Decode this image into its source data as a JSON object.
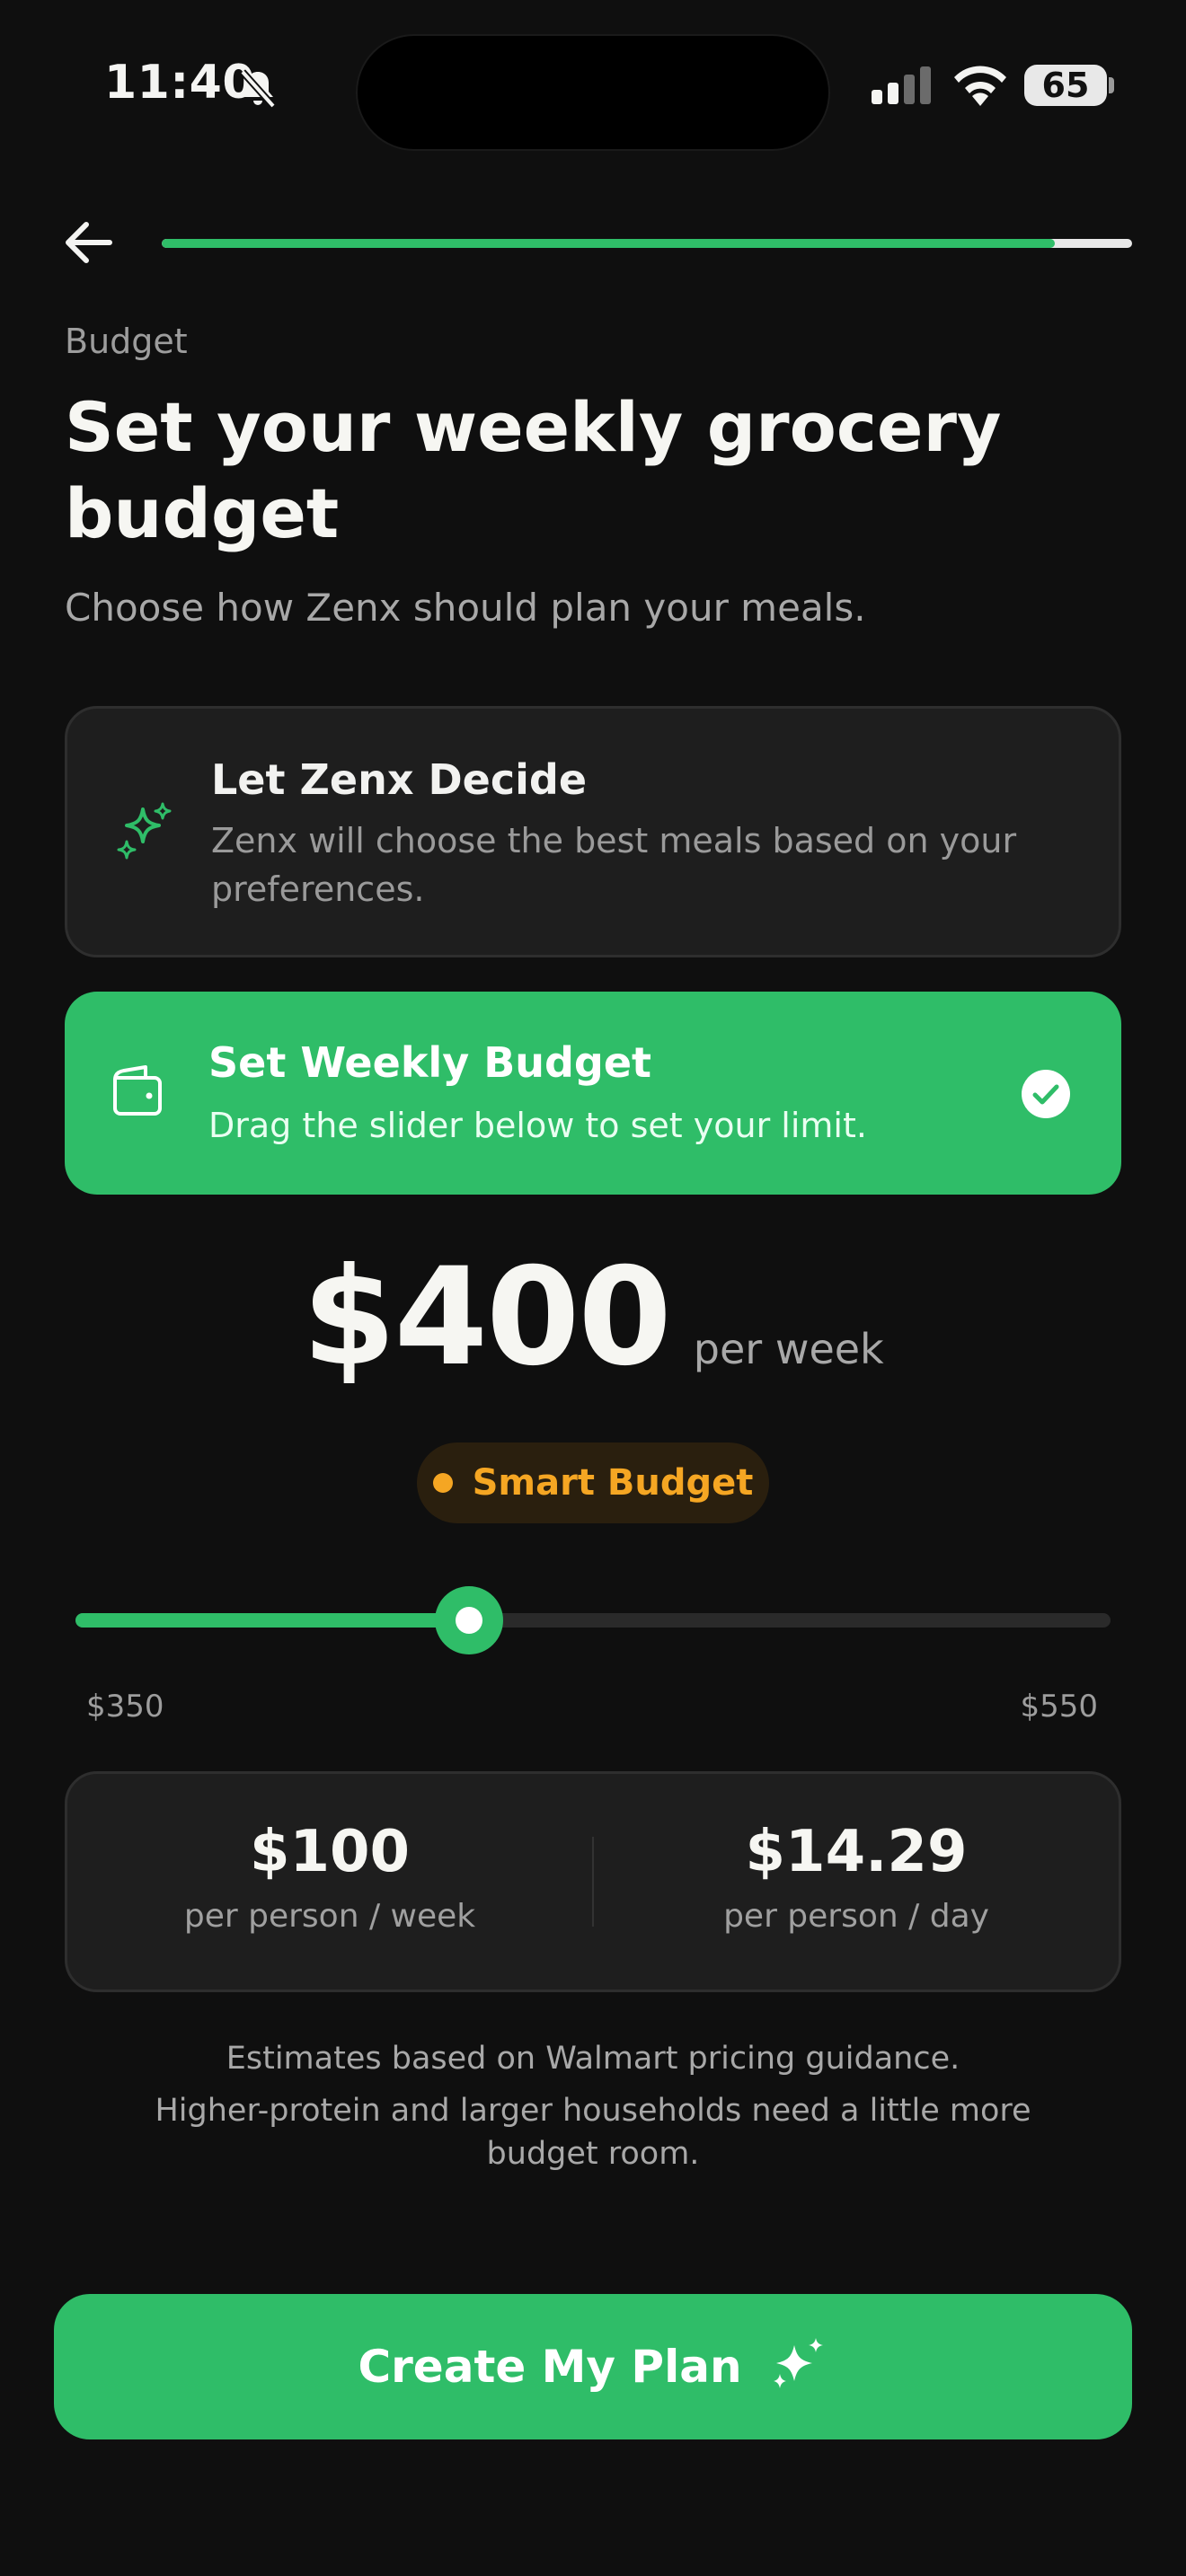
{
  "status_bar": {
    "time": "11:40",
    "battery": "65",
    "icons": [
      "bell-muted-icon",
      "cellular-signal-icon",
      "wifi-icon",
      "battery-icon"
    ]
  },
  "header": {
    "back_icon": "arrow-left-icon",
    "progress": 0.92
  },
  "page": {
    "eyebrow": "Budget",
    "title": "Set your weekly grocery budget",
    "subtitle": "Choose how Zenx should plan your meals."
  },
  "options": [
    {
      "title": "Let Zenx Decide",
      "description": "Zenx will choose the best meals based on your preferences.",
      "icon": "sparkles-icon",
      "selected": false
    },
    {
      "title": "Set Weekly Budget",
      "description": "Drag the slider below to set your limit.",
      "icon": "wallet-icon",
      "selected": true
    }
  ],
  "budget": {
    "amount": "$400",
    "unit": "per week",
    "badge": "Smart Budget",
    "min_label": "$350",
    "max_label": "$550",
    "value": 400,
    "min": 350,
    "max": 550
  },
  "stats": [
    {
      "value": "$100",
      "label": "per person / week"
    },
    {
      "value": "$14.29",
      "label": "per person / day"
    }
  ],
  "notes": {
    "line1": "Estimates based on Walmart pricing guidance.",
    "line2": "Higher-protein and larger households need a little more budget room."
  },
  "cta": {
    "label": "Create My Plan",
    "icon": "sparkles-icon"
  },
  "colors": {
    "background": "#0f0f0f",
    "accent_green": "#2fbd68",
    "badge_orange": "#f5a623",
    "card": "#1e1e1e"
  }
}
